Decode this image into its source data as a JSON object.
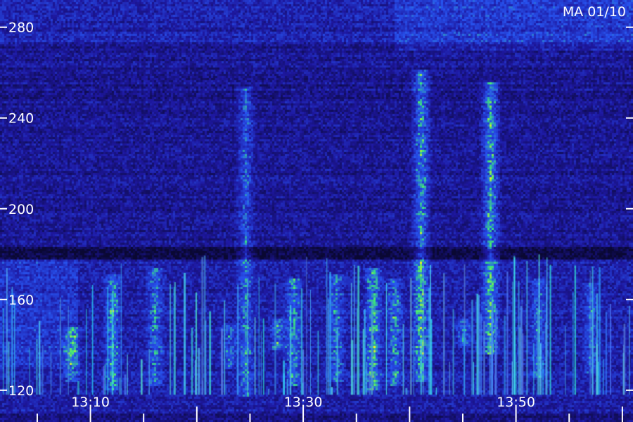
{
  "chart_data": {
    "type": "heatmap",
    "title": "MA 01/10",
    "xlabel": "",
    "ylabel": "",
    "x_ticks": [
      "13:10",
      "13:30",
      "13:50"
    ],
    "x_tick_minutes": [
      10,
      30,
      50
    ],
    "x_range_minutes": [
      1.5,
      61.0
    ],
    "y_ticks": [
      120,
      160,
      200,
      240,
      280
    ],
    "y_range": [
      106,
      292
    ],
    "grid": false,
    "colors": {
      "low": "#0a0a40",
      "mid": "#2040e0",
      "high": "#30f060",
      "peak": "#f0f020"
    },
    "bands": [
      {
        "name": "lower-band",
        "y_range": [
          110,
          178
        ]
      },
      {
        "name": "dark-gap",
        "y_range": [
          178,
          184
        ]
      },
      {
        "name": "upper-band",
        "y_range": [
          184,
          292
        ]
      }
    ],
    "bursts": [
      {
        "time_minutes": 8.2,
        "y_range": [
          124,
          148
        ],
        "intensity": 0.7
      },
      {
        "time_minutes": 12.0,
        "y_range": [
          120,
          172
        ],
        "intensity": 0.85
      },
      {
        "time_minutes": 16.0,
        "y_range": [
          122,
          174
        ],
        "intensity": 0.7
      },
      {
        "time_minutes": 23.0,
        "y_range": [
          130,
          150
        ],
        "intensity": 0.6
      },
      {
        "time_minutes": 24.5,
        "y_range": [
          118,
          254
        ],
        "intensity": 0.7
      },
      {
        "time_minutes": 27.5,
        "y_range": [
          138,
          152
        ],
        "intensity": 0.75
      },
      {
        "time_minutes": 29.0,
        "y_range": [
          122,
          170
        ],
        "intensity": 0.8
      },
      {
        "time_minutes": 33.0,
        "y_range": [
          124,
          172
        ],
        "intensity": 0.7
      },
      {
        "time_minutes": 36.5,
        "y_range": [
          120,
          174
        ],
        "intensity": 0.95
      },
      {
        "time_minutes": 38.5,
        "y_range": [
          122,
          170
        ],
        "intensity": 0.75
      },
      {
        "time_minutes": 41.0,
        "y_range": [
          124,
          262
        ],
        "intensity": 1.0
      },
      {
        "time_minutes": 45.0,
        "y_range": [
          140,
          152
        ],
        "intensity": 0.7
      },
      {
        "time_minutes": 47.5,
        "y_range": [
          136,
          256
        ],
        "intensity": 1.0
      },
      {
        "time_minutes": 52.0,
        "y_range": [
          126,
          170
        ],
        "intensity": 0.65
      },
      {
        "time_minutes": 57.0,
        "y_range": [
          128,
          168
        ],
        "intensity": 0.6
      }
    ]
  }
}
